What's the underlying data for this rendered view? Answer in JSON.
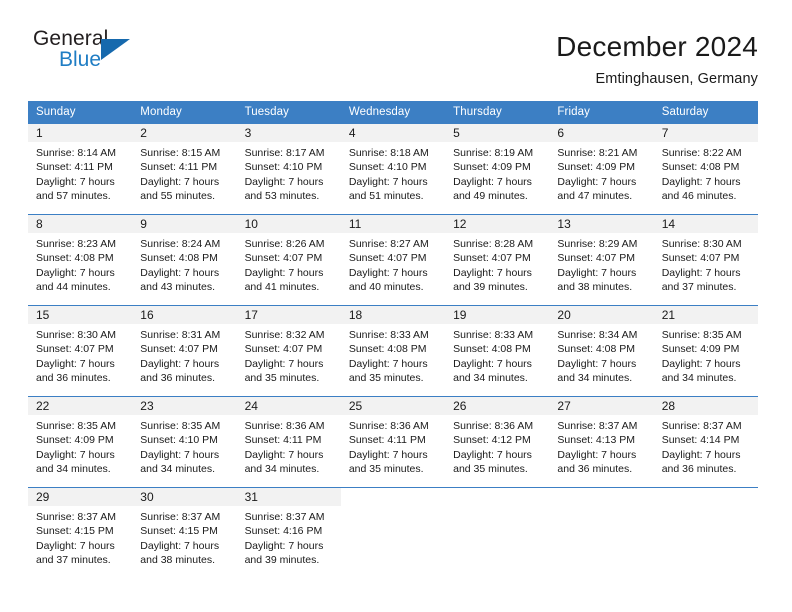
{
  "logo": {
    "word1": "General",
    "word2": "Blue",
    "triangle_color": "#1669ad",
    "blue_text_color": "#1f7dc4"
  },
  "header": {
    "title": "December 2024",
    "location": "Emtinghausen, Germany"
  },
  "theme": {
    "header_blue": "#3c7fc4",
    "band_gray": "#f2f2f2"
  },
  "weekday_headers": [
    "Sunday",
    "Monday",
    "Tuesday",
    "Wednesday",
    "Thursday",
    "Friday",
    "Saturday"
  ],
  "weeks": [
    [
      {
        "day": "1",
        "sunrise": "Sunrise: 8:14 AM",
        "sunset": "Sunset: 4:11 PM",
        "daylight1": "Daylight: 7 hours",
        "daylight2": "and 57 minutes."
      },
      {
        "day": "2",
        "sunrise": "Sunrise: 8:15 AM",
        "sunset": "Sunset: 4:11 PM",
        "daylight1": "Daylight: 7 hours",
        "daylight2": "and 55 minutes."
      },
      {
        "day": "3",
        "sunrise": "Sunrise: 8:17 AM",
        "sunset": "Sunset: 4:10 PM",
        "daylight1": "Daylight: 7 hours",
        "daylight2": "and 53 minutes."
      },
      {
        "day": "4",
        "sunrise": "Sunrise: 8:18 AM",
        "sunset": "Sunset: 4:10 PM",
        "daylight1": "Daylight: 7 hours",
        "daylight2": "and 51 minutes."
      },
      {
        "day": "5",
        "sunrise": "Sunrise: 8:19 AM",
        "sunset": "Sunset: 4:09 PM",
        "daylight1": "Daylight: 7 hours",
        "daylight2": "and 49 minutes."
      },
      {
        "day": "6",
        "sunrise": "Sunrise: 8:21 AM",
        "sunset": "Sunset: 4:09 PM",
        "daylight1": "Daylight: 7 hours",
        "daylight2": "and 47 minutes."
      },
      {
        "day": "7",
        "sunrise": "Sunrise: 8:22 AM",
        "sunset": "Sunset: 4:08 PM",
        "daylight1": "Daylight: 7 hours",
        "daylight2": "and 46 minutes."
      }
    ],
    [
      {
        "day": "8",
        "sunrise": "Sunrise: 8:23 AM",
        "sunset": "Sunset: 4:08 PM",
        "daylight1": "Daylight: 7 hours",
        "daylight2": "and 44 minutes."
      },
      {
        "day": "9",
        "sunrise": "Sunrise: 8:24 AM",
        "sunset": "Sunset: 4:08 PM",
        "daylight1": "Daylight: 7 hours",
        "daylight2": "and 43 minutes."
      },
      {
        "day": "10",
        "sunrise": "Sunrise: 8:26 AM",
        "sunset": "Sunset: 4:07 PM",
        "daylight1": "Daylight: 7 hours",
        "daylight2": "and 41 minutes."
      },
      {
        "day": "11",
        "sunrise": "Sunrise: 8:27 AM",
        "sunset": "Sunset: 4:07 PM",
        "daylight1": "Daylight: 7 hours",
        "daylight2": "and 40 minutes."
      },
      {
        "day": "12",
        "sunrise": "Sunrise: 8:28 AM",
        "sunset": "Sunset: 4:07 PM",
        "daylight1": "Daylight: 7 hours",
        "daylight2": "and 39 minutes."
      },
      {
        "day": "13",
        "sunrise": "Sunrise: 8:29 AM",
        "sunset": "Sunset: 4:07 PM",
        "daylight1": "Daylight: 7 hours",
        "daylight2": "and 38 minutes."
      },
      {
        "day": "14",
        "sunrise": "Sunrise: 8:30 AM",
        "sunset": "Sunset: 4:07 PM",
        "daylight1": "Daylight: 7 hours",
        "daylight2": "and 37 minutes."
      }
    ],
    [
      {
        "day": "15",
        "sunrise": "Sunrise: 8:30 AM",
        "sunset": "Sunset: 4:07 PM",
        "daylight1": "Daylight: 7 hours",
        "daylight2": "and 36 minutes."
      },
      {
        "day": "16",
        "sunrise": "Sunrise: 8:31 AM",
        "sunset": "Sunset: 4:07 PM",
        "daylight1": "Daylight: 7 hours",
        "daylight2": "and 36 minutes."
      },
      {
        "day": "17",
        "sunrise": "Sunrise: 8:32 AM",
        "sunset": "Sunset: 4:07 PM",
        "daylight1": "Daylight: 7 hours",
        "daylight2": "and 35 minutes."
      },
      {
        "day": "18",
        "sunrise": "Sunrise: 8:33 AM",
        "sunset": "Sunset: 4:08 PM",
        "daylight1": "Daylight: 7 hours",
        "daylight2": "and 35 minutes."
      },
      {
        "day": "19",
        "sunrise": "Sunrise: 8:33 AM",
        "sunset": "Sunset: 4:08 PM",
        "daylight1": "Daylight: 7 hours",
        "daylight2": "and 34 minutes."
      },
      {
        "day": "20",
        "sunrise": "Sunrise: 8:34 AM",
        "sunset": "Sunset: 4:08 PM",
        "daylight1": "Daylight: 7 hours",
        "daylight2": "and 34 minutes."
      },
      {
        "day": "21",
        "sunrise": "Sunrise: 8:35 AM",
        "sunset": "Sunset: 4:09 PM",
        "daylight1": "Daylight: 7 hours",
        "daylight2": "and 34 minutes."
      }
    ],
    [
      {
        "day": "22",
        "sunrise": "Sunrise: 8:35 AM",
        "sunset": "Sunset: 4:09 PM",
        "daylight1": "Daylight: 7 hours",
        "daylight2": "and 34 minutes."
      },
      {
        "day": "23",
        "sunrise": "Sunrise: 8:35 AM",
        "sunset": "Sunset: 4:10 PM",
        "daylight1": "Daylight: 7 hours",
        "daylight2": "and 34 minutes."
      },
      {
        "day": "24",
        "sunrise": "Sunrise: 8:36 AM",
        "sunset": "Sunset: 4:11 PM",
        "daylight1": "Daylight: 7 hours",
        "daylight2": "and 34 minutes."
      },
      {
        "day": "25",
        "sunrise": "Sunrise: 8:36 AM",
        "sunset": "Sunset: 4:11 PM",
        "daylight1": "Daylight: 7 hours",
        "daylight2": "and 35 minutes."
      },
      {
        "day": "26",
        "sunrise": "Sunrise: 8:36 AM",
        "sunset": "Sunset: 4:12 PM",
        "daylight1": "Daylight: 7 hours",
        "daylight2": "and 35 minutes."
      },
      {
        "day": "27",
        "sunrise": "Sunrise: 8:37 AM",
        "sunset": "Sunset: 4:13 PM",
        "daylight1": "Daylight: 7 hours",
        "daylight2": "and 36 minutes."
      },
      {
        "day": "28",
        "sunrise": "Sunrise: 8:37 AM",
        "sunset": "Sunset: 4:14 PM",
        "daylight1": "Daylight: 7 hours",
        "daylight2": "and 36 minutes."
      }
    ],
    [
      {
        "day": "29",
        "sunrise": "Sunrise: 8:37 AM",
        "sunset": "Sunset: 4:15 PM",
        "daylight1": "Daylight: 7 hours",
        "daylight2": "and 37 minutes."
      },
      {
        "day": "30",
        "sunrise": "Sunrise: 8:37 AM",
        "sunset": "Sunset: 4:15 PM",
        "daylight1": "Daylight: 7 hours",
        "daylight2": "and 38 minutes."
      },
      {
        "day": "31",
        "sunrise": "Sunrise: 8:37 AM",
        "sunset": "Sunset: 4:16 PM",
        "daylight1": "Daylight: 7 hours",
        "daylight2": "and 39 minutes."
      },
      {
        "day": "",
        "sunrise": "",
        "sunset": "",
        "daylight1": "",
        "daylight2": ""
      },
      {
        "day": "",
        "sunrise": "",
        "sunset": "",
        "daylight1": "",
        "daylight2": ""
      },
      {
        "day": "",
        "sunrise": "",
        "sunset": "",
        "daylight1": "",
        "daylight2": ""
      },
      {
        "day": "",
        "sunrise": "",
        "sunset": "",
        "daylight1": "",
        "daylight2": ""
      }
    ]
  ]
}
